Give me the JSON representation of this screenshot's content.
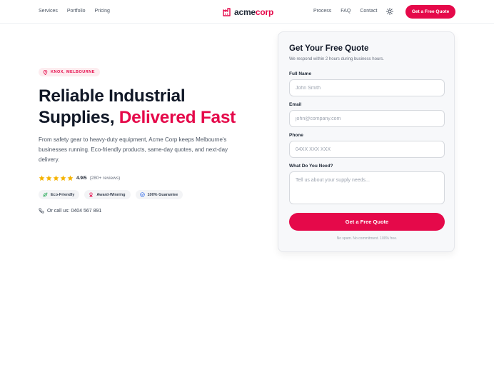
{
  "nav": {
    "left_links": [
      "Services",
      "Portfolio",
      "Pricing"
    ],
    "brand": {
      "prefix": "acme",
      "suffix": "corp"
    },
    "right_links": [
      "Process",
      "FAQ",
      "Contact"
    ],
    "theme_icon": "sun-icon",
    "cta": "Get a Free Quote"
  },
  "hero": {
    "location": "KNOX, MELBOURNE",
    "headline_line1": "Reliable Industrial",
    "headline_line2_plain": "Supplies, ",
    "headline_line2_accent": "Delivered Fast",
    "lead": "From safety gear to heavy-duty equipment, Acme Corp keeps Melbourne's businesses running. Eco-friendly products, same-day quotes, and next-day delivery.",
    "rating": {
      "stars": 5,
      "score": "4.9/5",
      "count": "(280+ reviews)"
    },
    "badges": [
      {
        "label": "Eco-Friendly",
        "icon": "leaf-icon"
      },
      {
        "label": "Award-Winning",
        "icon": "award-icon"
      },
      {
        "label": "100% Guarantee",
        "icon": "check-shield-icon"
      }
    ],
    "call": "Or call us: 0404 567 891"
  },
  "form": {
    "title": "Get Your Free Quote",
    "subtitle": "We respond within 2 hours during business hours.",
    "fields": {
      "name": {
        "label": "Full Name",
        "placeholder": "John Smith"
      },
      "email": {
        "label": "Email",
        "placeholder": "john@company.com"
      },
      "phone": {
        "label": "Phone",
        "placeholder": "04XX XXX XXX"
      },
      "need": {
        "label": "What Do You Need?",
        "placeholder": "Tell us about your supply needs..."
      }
    },
    "submit": "Get a Free Quote",
    "fine_print": "No spam. No commitment. 100% free."
  },
  "colors": {
    "accent": "#e5094a",
    "star": "#f5b301",
    "text": "#111827"
  }
}
